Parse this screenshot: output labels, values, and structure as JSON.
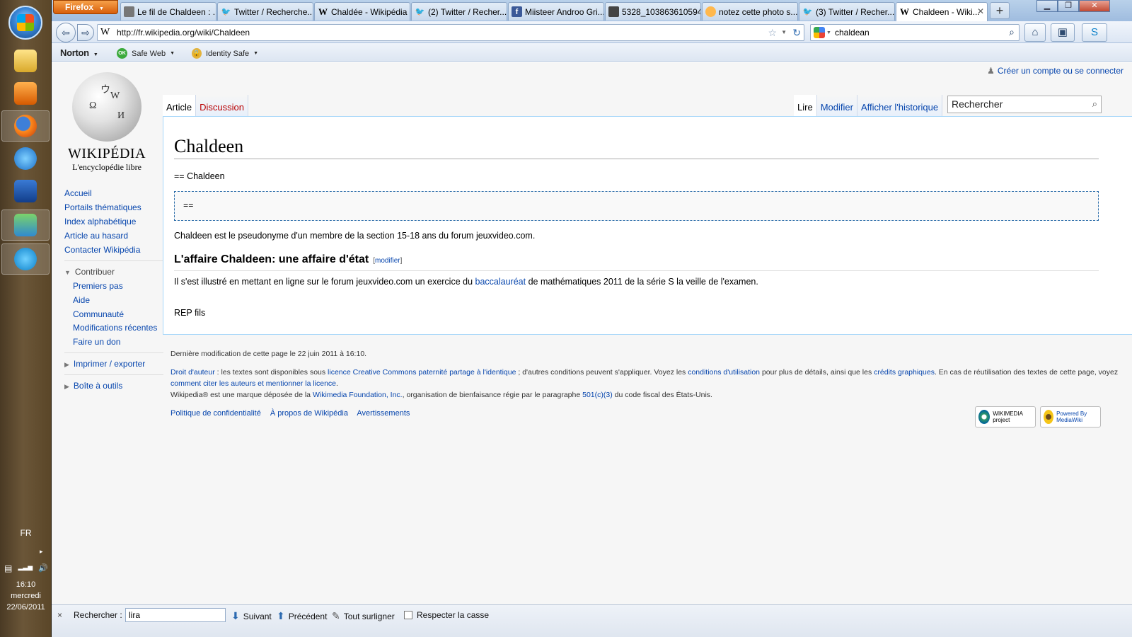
{
  "taskbar": {
    "lang": "FR",
    "arrow": "▸",
    "tray_icons": [
      "▤",
      "▂▃▅",
      "🔊"
    ],
    "time": "16:10",
    "day": "mercredi",
    "date": "22/06/2011"
  },
  "browser": {
    "firefox_label": "Firefox",
    "tabs": [
      {
        "label": "Le fil de Chaldeen : ...",
        "icon": "photo-icon"
      },
      {
        "label": "Twitter / Recherche...",
        "icon": "twitter-icon"
      },
      {
        "label": "Chaldée - Wikipédia",
        "icon": "wikipedia-icon"
      },
      {
        "label": "(2) Twitter / Recher...",
        "icon": "twitter-icon"
      },
      {
        "label": "Miisteer Androo Gri...",
        "icon": "facebook-icon"
      },
      {
        "label": "5328_103863610594...",
        "icon": "image-icon"
      },
      {
        "label": "notez cette photo s...",
        "icon": "chat-icon"
      },
      {
        "label": "(3) Twitter / Recher...",
        "icon": "twitter-icon"
      },
      {
        "label": "Chaldeen - Wiki...",
        "icon": "wikipedia-icon"
      }
    ],
    "new_tab": "+",
    "url": "http://fr.wikipedia.org/wiki/Chaldeen",
    "search_value": "chaldean",
    "norton": {
      "logo": "Norton",
      "safe_web": "Safe Web",
      "ok": "OK",
      "identity_safe": "Identity Safe"
    }
  },
  "wiki": {
    "personal_link": "Créer un compte ou se connecter",
    "wordmark": "WIKIPÉDIA",
    "tagline": "L'encyclopédie libre",
    "nav": [
      "Accueil",
      "Portails thématiques",
      "Index alphabétique",
      "Article au hasard",
      "Contacter Wikipédia"
    ],
    "contribute_head": "Contribuer",
    "contribute": [
      "Premiers pas",
      "Aide",
      "Communauté",
      "Modifications récentes",
      "Faire un don"
    ],
    "print_head": "Imprimer / exporter",
    "tools_head": "Boîte à outils",
    "tabs_left": [
      "Article",
      "Discussion"
    ],
    "tabs_right": [
      "Lire",
      "Modifier",
      "Afficher l'historique"
    ],
    "search_placeholder": "Rechercher",
    "title": "Chaldeen",
    "line1": "== Chaldeen",
    "pre": "==",
    "intro": "Chaldeen est le pseudonyme d'un membre de la section 15-18 ans du forum jeuxvideo.com.",
    "h2": "L'affaire Chaldeen: une affaire d'état",
    "edit_open": "[",
    "edit_label": "modifier",
    "edit_close": "]",
    "para_before": "Il s'est illustré en mettant en ligne sur le forum jeuxvideo.com un exercice du ",
    "para_link": "baccalauréat",
    "para_after": " de mathématiques 2011 de la série S la veille de l'examen.",
    "rep": "REP fils"
  },
  "footer": {
    "last_mod": "Dernière modification de cette page le 22 juin 2011 à 16:10.",
    "l1_a": "Droit d'auteur",
    "l1_b": " : les textes sont disponibles sous ",
    "l1_c": "licence Creative Commons paternité partage à l'identique",
    "l1_d": " ; d'autres conditions peuvent s'appliquer. Voyez les ",
    "l1_e": "conditions d'utilisation",
    "l1_f": " pour plus de détails, ainsi que les ",
    "l1_g": "crédits graphiques",
    "l1_h": ". En cas de réutilisation des textes de cette page, voyez ",
    "l1_i": "comment citer les auteurs et mentionner la licence",
    "l1_j": ".",
    "l2_a": "Wikipedia® est une marque déposée de la ",
    "l2_b": "Wikimedia Foundation, Inc.",
    "l2_c": ", organisation de bienfaisance régie par le paragraphe ",
    "l2_d": "501(c)(3)",
    "l2_e": " du code fiscal des États-Unis.",
    "links": [
      "Politique de confidentialité",
      "À propos de Wikipédia",
      "Avertissements"
    ],
    "badge_wm": "WIKIMEDIA project",
    "badge_mw": "Powered By MediaWiki"
  },
  "findbar": {
    "close": "×",
    "label": "Rechercher :",
    "value": "lira",
    "next": "Suivant",
    "prev": "Précédent",
    "highlight": "Tout surligner",
    "match_case": "Respecter la casse"
  }
}
